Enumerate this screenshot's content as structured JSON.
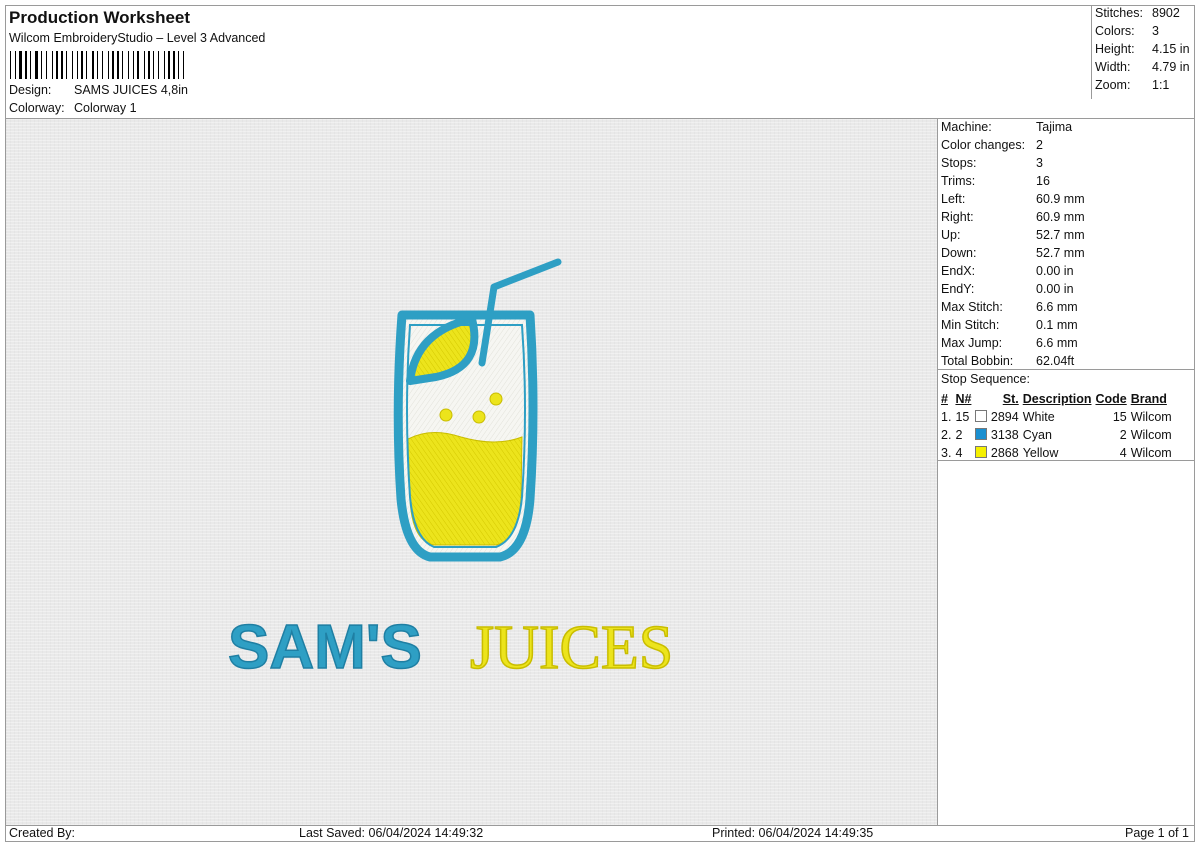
{
  "header": {
    "title": "Production Worksheet",
    "subtitle": "Wilcom EmbroideryStudio – Level 3 Advanced",
    "design_label": "Design:",
    "design_value": "SAMS JUICES 4,8in",
    "colorway_label": "Colorway:",
    "colorway_value": "Colorway 1"
  },
  "summary": {
    "stitches_label": "Stitches:",
    "stitches": "8902",
    "colors_label": "Colors:",
    "colors": "3",
    "height_label": "Height:",
    "height": "4.15 in",
    "width_label": "Width:",
    "width": "4.79 in",
    "zoom_label": "Zoom:",
    "zoom": "1:1"
  },
  "machine": [
    {
      "label": "Machine:",
      "value": "Tajima"
    },
    {
      "label": "Color changes:",
      "value": "2"
    },
    {
      "label": "Stops:",
      "value": "3"
    },
    {
      "label": "Trims:",
      "value": "16"
    },
    {
      "label": "Left:",
      "value": "60.9 mm"
    },
    {
      "label": "Right:",
      "value": "60.9 mm"
    },
    {
      "label": "Up:",
      "value": "52.7 mm"
    },
    {
      "label": "Down:",
      "value": "52.7 mm"
    },
    {
      "label": "EndX:",
      "value": "0.00 in"
    },
    {
      "label": "EndY:",
      "value": "0.00 in"
    },
    {
      "label": "Max Stitch:",
      "value": "6.6 mm"
    },
    {
      "label": "Min Stitch:",
      "value": "0.1 mm"
    },
    {
      "label": "Max Jump:",
      "value": "6.6 mm"
    },
    {
      "label": "Total Bobbin:",
      "value": "62.04ft"
    }
  ],
  "stop_sequence": {
    "title": "Stop Sequence:",
    "columns": [
      "#",
      "N#",
      "St.",
      "Description",
      "Code",
      "Brand"
    ],
    "rows": [
      {
        "idx": "1.",
        "n": "15",
        "color": "#ffffff",
        "st": "2894",
        "desc": "White",
        "code": "15",
        "brand": "Wilcom"
      },
      {
        "idx": "2.",
        "n": "2",
        "color": "#1a8fd0",
        "st": "3138",
        "desc": "Cyan",
        "code": "2",
        "brand": "Wilcom"
      },
      {
        "idx": "3.",
        "n": "4",
        "color": "#f5f000",
        "st": "2868",
        "desc": "Yellow",
        "code": "4",
        "brand": "Wilcom"
      }
    ]
  },
  "design_preview": {
    "text_part1": "SAM'S",
    "text_part2": "JUICES",
    "cyan_thread": "#2e9fc4",
    "yellow_thread": "#ece41c"
  },
  "footer": {
    "created_by": "Created By:",
    "last_saved": "Last Saved: 06/04/2024 14:49:32",
    "printed": "Printed: 06/04/2024 14:49:35",
    "page": "Page 1 of 1"
  }
}
